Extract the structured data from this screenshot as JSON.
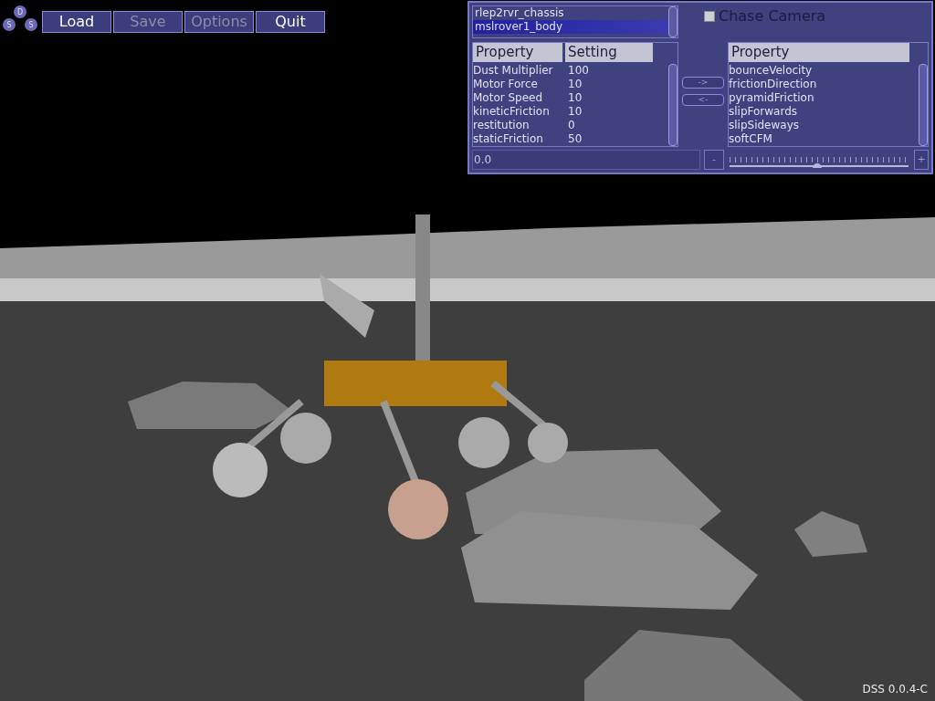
{
  "toolbar": {
    "logo_letters": [
      "D",
      "S",
      "S"
    ],
    "buttons": [
      {
        "label": "Load",
        "disabled": false
      },
      {
        "label": "Save",
        "disabled": true
      },
      {
        "label": "Options",
        "disabled": true
      },
      {
        "label": "Quit",
        "disabled": false
      }
    ]
  },
  "panel": {
    "objects": [
      {
        "label": "rlep2rvr_chassis",
        "selected": false
      },
      {
        "label": "mslrover1_body",
        "selected": true
      }
    ],
    "chase_camera": {
      "label": "Chase Camera",
      "checked": false
    },
    "properties_table": {
      "columns": [
        "Property",
        "Setting"
      ],
      "rows": [
        [
          "Dust Multiplier",
          "100"
        ],
        [
          "Motor Force",
          "10"
        ],
        [
          "Motor Speed",
          "10"
        ],
        [
          "kineticFriction",
          "10"
        ],
        [
          "restitution",
          "0"
        ],
        [
          "staticFriction",
          "50"
        ]
      ]
    },
    "move_right": "->",
    "move_left": "<-",
    "available_table": {
      "columns": [
        "Property"
      ],
      "rows": [
        "bounceVelocity",
        "frictionDirection",
        "pyramidFriction",
        "slipForwards",
        "slipSideways",
        "softCFM"
      ]
    },
    "value_field": {
      "value": "0.0"
    },
    "slider": {
      "minus": "-",
      "plus": "+",
      "level": 0.49
    }
  },
  "version": "DSS 0.0.4-C"
}
